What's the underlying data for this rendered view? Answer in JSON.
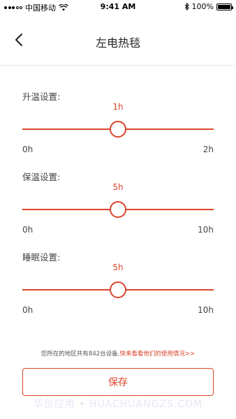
{
  "status_bar": {
    "carrier": "中国移动",
    "time": "9:41 AM",
    "battery": "100%"
  },
  "nav": {
    "title": "左电热毯"
  },
  "sections": [
    {
      "label": "升温设置:",
      "value": "1h",
      "min": "0h",
      "max": "2h",
      "fraction": 0.5
    },
    {
      "label": "保温设置:",
      "value": "5h",
      "min": "0h",
      "max": "10h",
      "fraction": 0.5
    },
    {
      "label": "睡眠设置:",
      "value": "5h",
      "min": "0h",
      "max": "10h",
      "fraction": 0.5
    }
  ],
  "footer": {
    "note": "您所在的地区共有842台设备,",
    "link": "快来看看他们的使用情况>>"
  },
  "save_label": "保存",
  "watermark": "华创应用 • HUACHUANGZS.COM",
  "colors": {
    "accent": "#d9442a"
  }
}
